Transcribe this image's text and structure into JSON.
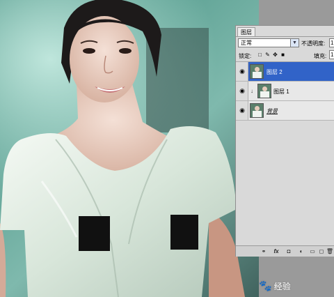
{
  "layers_panel": {
    "tab_label": "图层",
    "blend_mode": "正常",
    "opacity_label": "不透明度:",
    "opacity_value": "1",
    "lock_label": "锁定:",
    "fill_label": "填充:",
    "fill_value": "1",
    "layers": [
      {
        "name": "图层 2",
        "selected": true
      },
      {
        "name": "图层 1",
        "selected": false,
        "clipped": true
      },
      {
        "name": "背景",
        "selected": false
      }
    ],
    "bottom_icons": [
      "link-icon",
      "fx-icon",
      "mask-icon",
      "adjustment-icon",
      "folder-icon",
      "new-layer-icon",
      "trash-icon"
    ]
  },
  "watermark": {
    "text": "经验"
  },
  "colors": {
    "selection": "#3163c8",
    "panel_bg": "#d9d9d9"
  }
}
